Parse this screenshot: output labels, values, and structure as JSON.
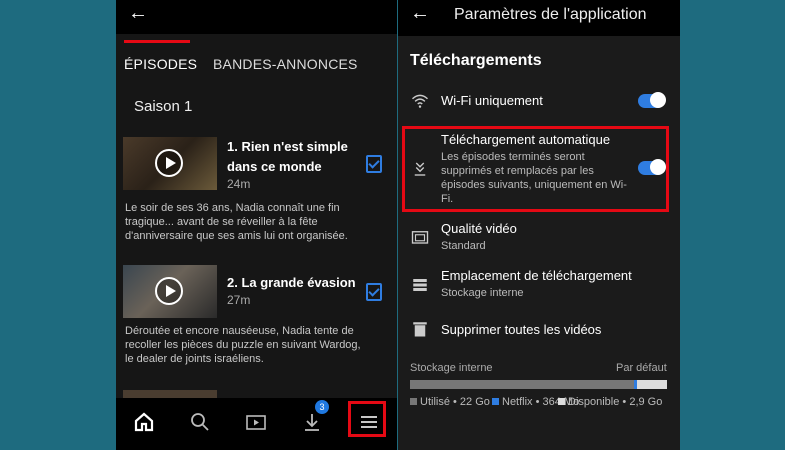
{
  "left": {
    "tabs": [
      {
        "label": "ÉPISODES"
      },
      {
        "label": "BANDES-ANNONCES"
      }
    ],
    "season": "Saison 1",
    "episodes": [
      {
        "title": "1. Rien n'est simple dans ce monde",
        "duration": "24m",
        "description": "Le soir de ses 36 ans, Nadia connaît une fin tragique... avant de se réveiller à la fête d'anniversaire que ses amis lui ont organisée."
      },
      {
        "title": "2. La grande évasion",
        "duration": "27m",
        "description": "Déroutée et encore nauséeuse, Nadia tente de recoller les pièces du puzzle en suivant Wardog, le dealer de joints israéliens."
      }
    ],
    "downloads_badge": "3"
  },
  "right": {
    "title": "Paramètres de l'application",
    "section": "Téléchargements",
    "wifi_only": {
      "label": "Wi-Fi uniquement",
      "enabled": true
    },
    "auto_download": {
      "label": "Téléchargement automatique",
      "description": "Les épisodes terminés seront supprimés et remplacés par les épisodes suivants, uniquement en Wi-Fi.",
      "enabled": true
    },
    "video_quality": {
      "label": "Qualité vidéo",
      "value": "Standard"
    },
    "download_location": {
      "label": "Emplacement de téléchargement",
      "value": "Stockage interne"
    },
    "delete_all": {
      "label": "Supprimer toutes les vidéos"
    },
    "storage": {
      "label": "Stockage interne",
      "default_label": "Par défaut",
      "used_fraction": 0.87,
      "netflix_fraction": 0.012,
      "legend": [
        {
          "label": "Utilisé • 22 Go",
          "color": "#777777"
        },
        {
          "label": "Netflix • 364 Mo",
          "color": "#2f7de1"
        },
        {
          "label": "Disponible • 2,9 Go",
          "color": "#dddddd"
        }
      ]
    }
  },
  "colors": {
    "accent": "#e50914",
    "toggle": "#2f7de1",
    "badge": "#1f78e0"
  }
}
